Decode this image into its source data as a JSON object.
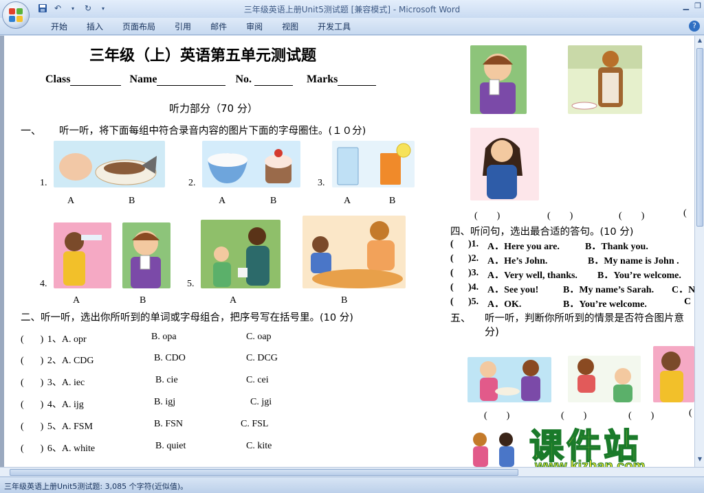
{
  "window": {
    "title": "三年级英语上册Unit5测试题 [兼容模式] - Microsoft Word",
    "minimize_icon": "minimize-icon",
    "restore_icon": "restore-icon",
    "close_icon": "close-icon"
  },
  "ribbon": {
    "tabs": [
      "开始",
      "插入",
      "页面布局",
      "引用",
      "邮件",
      "审阅",
      "视图",
      "开发工具"
    ],
    "help_label": "?"
  },
  "status": {
    "text": "三年级英语上册Unit5测试题: 3,085 个字符(近似值)。"
  },
  "doc": {
    "title": "三年级（上）英语第五单元测试题",
    "header": {
      "class": "Class",
      "name": "Name",
      "no": "No.",
      "marks": "Marks"
    },
    "listening_part": "听力部分（70 分）",
    "section1": {
      "num": "一、",
      "text": "听一听，将下面每组中符合录音内容的图片下面的字母圈住。(１０分)",
      "groups": [
        {
          "num": "1.",
          "a": "A",
          "b": "B"
        },
        {
          "num": "2.",
          "a": "A",
          "b": "B"
        },
        {
          "num": "3.",
          "a": "A",
          "b": "B"
        },
        {
          "num": "4.",
          "a": "A",
          "b": "B"
        },
        {
          "num": "5.",
          "a": "A",
          "b": "B"
        }
      ]
    },
    "section2": {
      "text": "二、听一听，选出你所听到的单词或字母组合，把序号写在括号里。(10 分)",
      "items": [
        {
          "paren": "(",
          "close": ")",
          "num": "1、",
          "a": "A. opr",
          "b": "B. opa",
          "c": "C. oap"
        },
        {
          "paren": "(",
          "close": ")",
          "num": "2、",
          "a": "A. CDG",
          "b": "B. CDO",
          "c": "C. DCG"
        },
        {
          "paren": "(",
          "close": ")",
          "num": "3、",
          "a": "A. iec",
          "b": "B. cie",
          "c": "C. cei"
        },
        {
          "paren": "(",
          "close": ")",
          "num": "4、",
          "a": "A. ijg",
          "b": "B. igj",
          "c": "C. jgi"
        },
        {
          "paren": "(",
          "close": ")",
          "num": "5、",
          "a": "A. FSM",
          "b": "B. FSN",
          "c": "C. FSL"
        },
        {
          "paren": "(",
          "close": ")",
          "num": "6、",
          "a": "A. white",
          "b": "B. quiet",
          "c": "C. kite"
        }
      ]
    },
    "section3_parens": [
      "(　　)",
      "(　　)",
      "(　　)",
      "("
    ],
    "section4": {
      "text": "四、听问句，选出最合适的答句。(10 分)",
      "items": [
        {
          "paren": "(",
          "num": ")1.",
          "a": "A．Here you are.",
          "b": "B．Thank you."
        },
        {
          "paren": "(",
          "num": ")2.",
          "a": "A．He’s John.",
          "b": "B．My name is John ."
        },
        {
          "paren": "(",
          "num": ")3.",
          "a": "A．Very well, thanks.",
          "b": "B．You’re welcome."
        },
        {
          "paren": "(",
          "num": ")4.",
          "a": "A．See you!",
          "b": "B．My name’s Sarah.",
          "c": "C．N"
        },
        {
          "paren": "(",
          "num": ")5.",
          "a": "A．OK.",
          "b": "B．You’re welcome.",
          "c": "C"
        }
      ]
    },
    "section5": {
      "num": "五、",
      "text": "听一听，判断你所听到的情景是否符合图片意",
      "text2": "分)",
      "parens": [
        "(　　)",
        "(　　)",
        "(　　)",
        "("
      ]
    },
    "watermark": {
      "cn": "课件站",
      "url": "www.kjzhan.com"
    }
  },
  "colors": {
    "office_red": "#e0412c",
    "office_green": "#5bb33a",
    "office_blue": "#2f7fd0",
    "office_yellow": "#f5c12c",
    "watermark_fill": "#f7e83a",
    "watermark_stroke": "#1a7a2a"
  }
}
